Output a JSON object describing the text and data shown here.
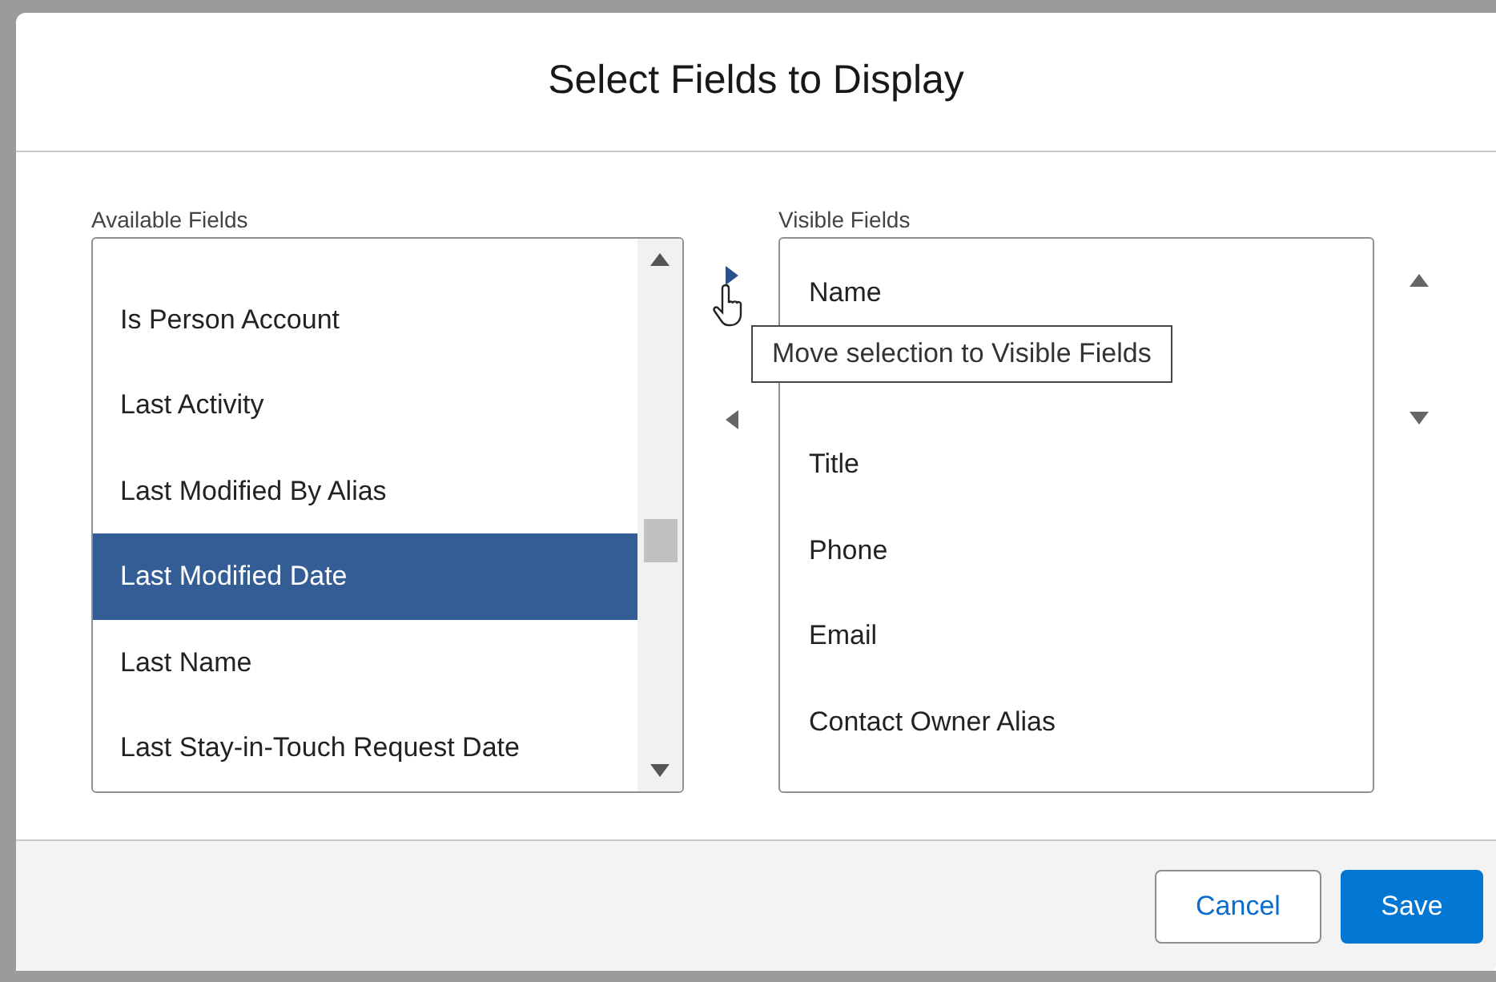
{
  "dialog": {
    "title": "Select Fields to Display"
  },
  "available": {
    "label": "Available Fields",
    "items": [
      {
        "text": "Is Person Account",
        "selected": false
      },
      {
        "text": "Last Activity",
        "selected": false
      },
      {
        "text": "Last Modified By Alias",
        "selected": false
      },
      {
        "text": "Last Modified Date",
        "selected": true
      },
      {
        "text": "Last Name",
        "selected": false
      },
      {
        "text": "Last Stay-in-Touch Request Date",
        "selected": false
      }
    ]
  },
  "visible": {
    "label": "Visible Fields",
    "items": [
      {
        "text": "Name",
        "selected": false
      },
      {
        "text": "Title",
        "selected": false
      },
      {
        "text": "Phone",
        "selected": false
      },
      {
        "text": "Email",
        "selected": false
      },
      {
        "text": "Contact Owner Alias",
        "selected": false
      }
    ]
  },
  "tooltip": "Move selection to Visible Fields",
  "buttons": [
    {
      "label": "Cancel",
      "kind": "neutral"
    },
    {
      "label": "Save",
      "kind": "brand"
    }
  ]
}
